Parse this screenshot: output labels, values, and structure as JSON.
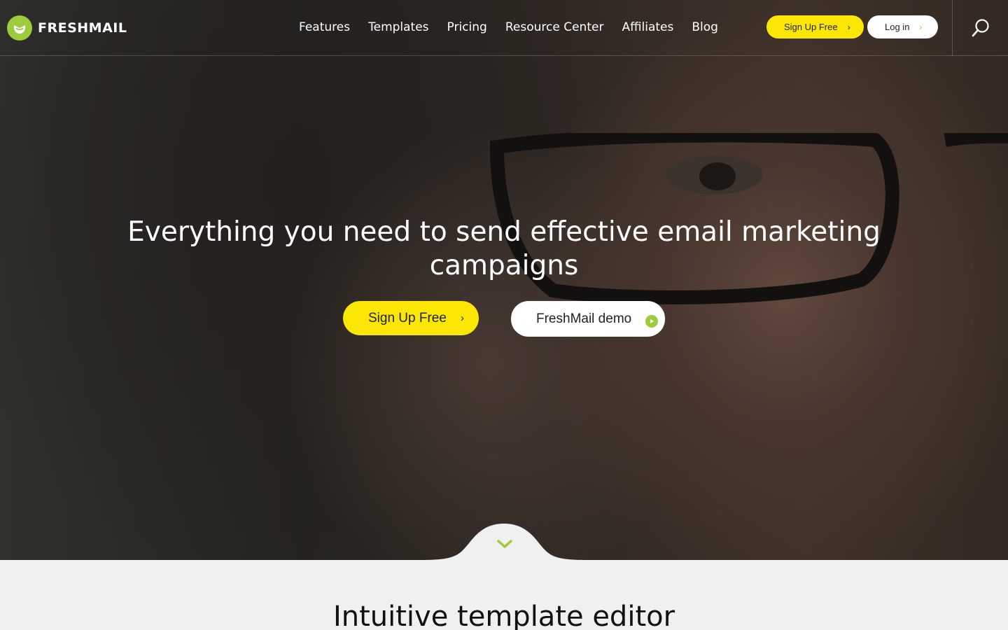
{
  "brand": {
    "name": "FRESHMAIL"
  },
  "nav": {
    "items": [
      {
        "label": "Features"
      },
      {
        "label": "Templates"
      },
      {
        "label": "Pricing"
      },
      {
        "label": "Resource Center"
      },
      {
        "label": "Affiliates"
      },
      {
        "label": "Blog"
      }
    ],
    "signup_label": "Sign Up Free",
    "login_label": "Log in",
    "search_icon": "search-icon"
  },
  "hero": {
    "headline": "Everything you need to send effective email marketing campaigns",
    "signup_label": "Sign Up Free",
    "demo_label": "FreshMail demo",
    "scroll_icon": "chevron-down-icon"
  },
  "section": {
    "title": "Intuitive template editor"
  },
  "colors": {
    "accent_yellow": "#fbe605",
    "brand_green": "#9ccb3b",
    "section_bg": "#f0f0f0"
  }
}
